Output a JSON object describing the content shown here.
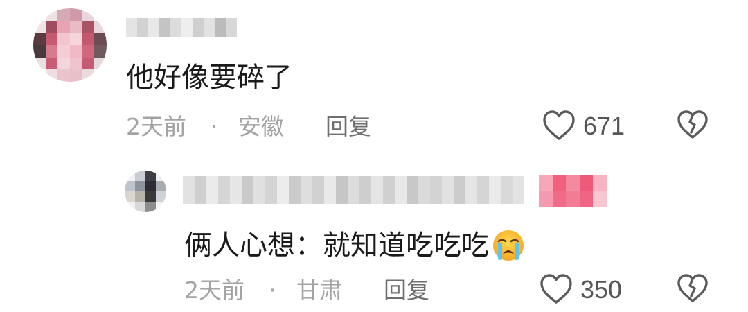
{
  "comment": {
    "text": "他好像要碎了",
    "time": "2天前",
    "dot": "·",
    "location": "安徽",
    "reply_label": "回复",
    "likes": "671"
  },
  "reply": {
    "text": "俩人心想：就知道吃吃吃",
    "emoji": "loudly-crying-face",
    "time": "2天前",
    "dot": "·",
    "location": "甘肃",
    "reply_label": "回复",
    "likes": "350"
  },
  "colors": {
    "text": "#1a1a1a",
    "meta": "#a3a3a3",
    "badge": "#f46a8a"
  }
}
